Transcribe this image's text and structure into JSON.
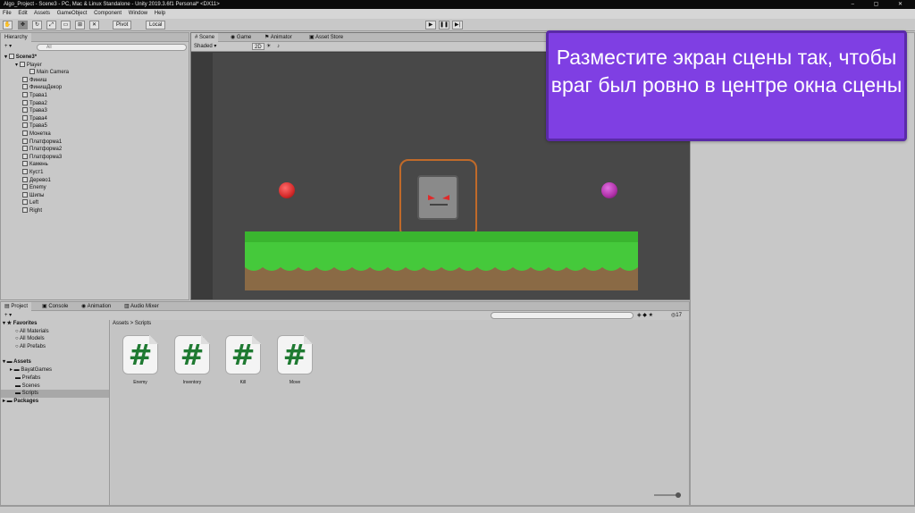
{
  "window": {
    "title": "Algo_Project - Scene3 - PC, Mac & Linux Standalone - Unity 2019.3.6f1 Personal* <DX11>"
  },
  "menu": [
    "File",
    "Edit",
    "Assets",
    "GameObject",
    "Component",
    "Window",
    "Help"
  ],
  "toolbar": {
    "pivot": "Pivot",
    "local": "Local"
  },
  "hierarchy": {
    "tab": "Hierarchy",
    "create": "+ ▾",
    "search_placeholder": "All",
    "scene": "Scene3*",
    "items": [
      "Player",
      "Main Camera",
      "Финиш",
      "ФинишДекор",
      "Трава1",
      "Трава2",
      "Трава3",
      "Трава4",
      "Трава5",
      "Монетка",
      "Платформа1",
      "Платформа2",
      "Платформа3",
      "Камень",
      "Куст1",
      "Дерево1",
      "Enemy",
      "Шипы",
      "Left",
      "Right"
    ]
  },
  "scene": {
    "tabs": [
      "Scene",
      "Game",
      "Animator",
      "Asset Store"
    ],
    "shading": "Shaded",
    "mode_2d": "2D",
    "colors": {
      "ground_top": "#45c93b",
      "ground_bottom": "#8a6a45",
      "highlight": "#c06a2a",
      "left_ball": "#d42a2a",
      "right_ball": "#b030a8"
    }
  },
  "project": {
    "tabs": [
      "Project",
      "Console",
      "Animation",
      "Audio Mixer"
    ],
    "favorites_label": "Favorites",
    "favorites": [
      "All Materials",
      "All Models",
      "All Prefabs"
    ],
    "assets_label": "Assets",
    "assets": [
      "BayatGames",
      "Prefabs",
      "Scenes",
      "Scripts"
    ],
    "packages_label": "Packages",
    "breadcrumb": "Assets > Scripts",
    "count": "17",
    "scripts": [
      {
        "name": "Enemy",
        "symbol": "#"
      },
      {
        "name": "Inventory",
        "symbol": "#"
      },
      {
        "name": "Kill",
        "symbol": "#"
      },
      {
        "name": "Move",
        "symbol": "#"
      }
    ]
  },
  "callout": {
    "text": "Разместите экран сцены так, чтобы враг был ровно в центре окна сцены",
    "color": "#7f3fe3"
  }
}
